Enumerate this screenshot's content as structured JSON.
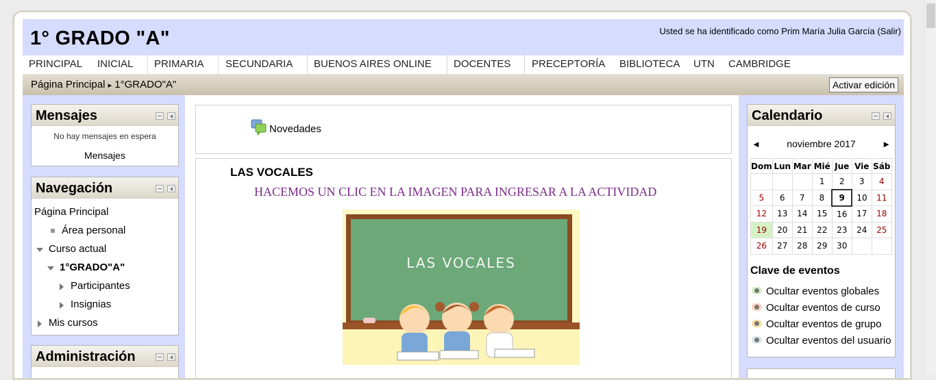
{
  "header": {
    "course_title": "1° GRADO \"A\"",
    "login_info": "Usted se ha identificado como Prim María Julia García (Salir)"
  },
  "menu": [
    "PRINCIPAL",
    "INICIAL",
    "PRIMARIA",
    "SECUNDARIA",
    "BUENOS AIRES ONLINE",
    "DOCENTES",
    "PRECEPTORÍA",
    "BIBLIOTECA",
    "UTN",
    "CAMBRIDGE"
  ],
  "breadcrumb": {
    "home": "Página Principal",
    "separator": "▸",
    "current": "1°GRADO\"A\""
  },
  "edit_button": "Activar edición",
  "mensajes": {
    "title": "Mensajes",
    "empty_text": "No hay mensajes en espera",
    "link": "Mensajes"
  },
  "navegacion": {
    "title": "Navegación",
    "home": "Página Principal",
    "personal": "Área personal",
    "current_course": "Curso actual",
    "course": "1°GRADO\"A\"",
    "participants": "Participantes",
    "badges": "Insignias",
    "my_courses": "Mis cursos"
  },
  "administracion": {
    "title": "Administración"
  },
  "main": {
    "news_forum": "Novedades",
    "section_title": "LAS VOCALES",
    "instruction": "HACEMOS UN CLIC EN LA IMAGEN PARA INGRESAR A LA ACTIVIDAD",
    "image_text": "LAS VOCALES"
  },
  "calendario": {
    "title": "Calendario",
    "prev": "◄",
    "next": "►",
    "month": "noviembre 2017",
    "weekdays": [
      "Dom",
      "Lun",
      "Mar",
      "Mié",
      "Jue",
      "Vie",
      "Sáb"
    ],
    "weeks": [
      [
        "",
        "",
        "",
        "1",
        "2",
        "3",
        "4"
      ],
      [
        "5",
        "6",
        "7",
        "8",
        "9",
        "10",
        "11"
      ],
      [
        "12",
        "13",
        "14",
        "15",
        "16",
        "17",
        "18"
      ],
      [
        "19",
        "20",
        "21",
        "22",
        "23",
        "24",
        "25"
      ],
      [
        "26",
        "27",
        "28",
        "29",
        "30",
        "",
        ""
      ]
    ],
    "today": "9",
    "event_day": "19",
    "legend_title": "Clave de eventos",
    "legend": [
      {
        "label": "Ocultar eventos globales",
        "color": "#d4f0c4"
      },
      {
        "label": "Ocultar eventos de curso",
        "color": "#ffd3bd"
      },
      {
        "label": "Ocultar eventos de grupo",
        "color": "#fbe0a6"
      },
      {
        "label": "Ocultar eventos del usuario",
        "color": "#dce7ec"
      }
    ]
  },
  "colors": {
    "header_bg": "#d6dcff",
    "instruction_color": "#7b2a8a",
    "weekend_color": "#a00000"
  }
}
